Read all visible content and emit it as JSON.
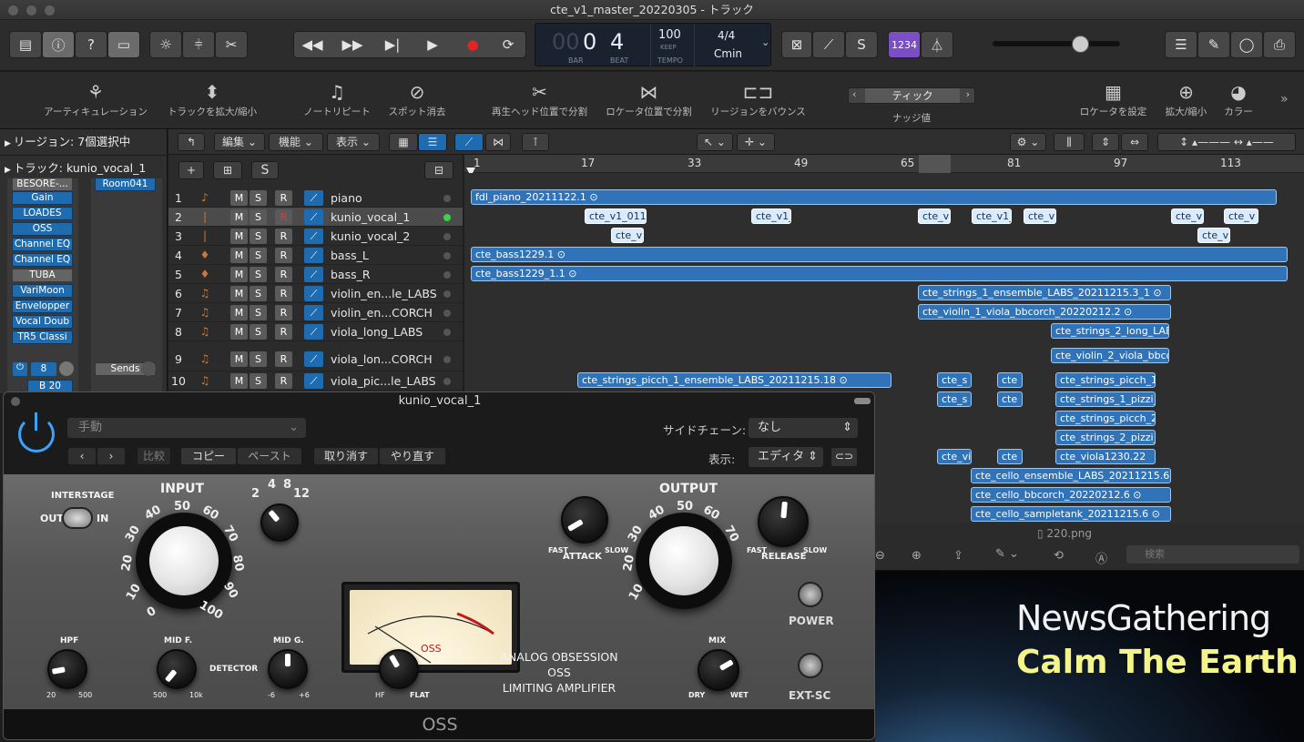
{
  "window": {
    "title": "cte_v1_master_20220305 - トラック"
  },
  "lcd": {
    "bar": "00",
    "beat_a": "0",
    "beat_b": "4",
    "bar_label": "BAR",
    "beat_label": "BEAT",
    "tempo": "100",
    "tempo_mode": "KEEP",
    "tempo_label": "TEMPO",
    "sig": "4/4",
    "key": "Cmin"
  },
  "toolbar": {
    "count_in": "1234"
  },
  "controlbar": {
    "items": [
      "アーティキュレーション",
      "トラックを拡大/縮小",
      "ノートリピート",
      "スポット消去",
      "再生ヘッド位置で分割",
      "ロケータ位置で分割",
      "リージョンをバウンス",
      "ナッジ値",
      "ロケータを設定",
      "拡大/縮小",
      "カラー"
    ],
    "nudge": "ティック"
  },
  "inspector": {
    "region_label": "リージョン:",
    "region_value": "7個選択中",
    "track_label": "トラック:",
    "track_value": "kunio_vocal_1",
    "slots": [
      "BESORE-...",
      "Gain",
      "LOADES",
      "OSS",
      "Channel EQ",
      "Channel EQ",
      "TUBA",
      "VariMoon",
      "Envelopper",
      "Vocal Doub",
      "TR5 Classi"
    ],
    "room": "Room041",
    "sends": "Sends",
    "bus": "B 20",
    "input": "8"
  },
  "menubar": {
    "edit": "編集",
    "func": "機能",
    "view": "表示"
  },
  "ruler": [
    "1",
    "17",
    "33",
    "49",
    "65",
    "81",
    "97",
    "113"
  ],
  "tracks": [
    {
      "num": "1",
      "name": "piano",
      "icon": "♪"
    },
    {
      "num": "2",
      "name": "kunio_vocal_1",
      "icon": "|"
    },
    {
      "num": "3",
      "name": "kunio_vocal_2",
      "icon": "|"
    },
    {
      "num": "4",
      "name": "bass_L",
      "icon": "♦"
    },
    {
      "num": "5",
      "name": "bass_R",
      "icon": "♦"
    },
    {
      "num": "6",
      "name": "violin_en...le_LABS",
      "icon": "♫"
    },
    {
      "num": "7",
      "name": "violin_en...CORCH",
      "icon": "♫"
    },
    {
      "num": "8",
      "name": "viola_long_LABS",
      "icon": "♫"
    },
    {
      "num": "9",
      "name": "viola_lon...CORCH",
      "icon": "♫"
    },
    {
      "num": "10",
      "name": "viola_pic...le_LABS",
      "icon": "♫"
    }
  ],
  "msr": {
    "m": "M",
    "s": "S",
    "r": "R"
  },
  "regions": [
    "fdl_piano_20211122.1",
    "cte_v1_011",
    "cte_v1_",
    "cte_v",
    "cte_v1_",
    "cte_v",
    "cte_v",
    "cte_v",
    "cte_v",
    "cte_v",
    "cte_bass1229.1",
    "cte_bass1229_1.1",
    "cte_strings_1_ensemble_LABS_20211215.3_1",
    "cte_violin_1_viola_bbcorch_20220212.2",
    "cte_strings_2_long_LAB",
    "cte_violin_2_viola_bbcor",
    "cte_strings_picch_1_ensemble_LABS_20211215.18",
    "cte_s",
    "cte",
    "cte_strings_picch_1",
    "cte_s",
    "cte",
    "cte_strings_1_pizzi_",
    "cte_strings_picch_2",
    "cte_strings_2_pizzi_",
    "cte_vi",
    "cte",
    "cte_viola1230.22",
    "cte_cello_ensemble_LABS_20211215.6",
    "cte_cello_bbcorch_20220212.6",
    "cte_cello_sampletank_20211215.6"
  ],
  "plugin": {
    "title": "kunio_vocal_1",
    "preset": "手動",
    "sidechain_label": "サイドチェーン:",
    "sidechain": "なし",
    "compare": "比較",
    "copy": "コピー",
    "paste": "ペースト",
    "undo": "取り消す",
    "redo": "やり直す",
    "view_label": "表示:",
    "view": "エディタ",
    "footer": "OSS"
  },
  "oss": {
    "interstage": "INTERSTAGE",
    "out": "OUT",
    "in": "IN",
    "input": "INPUT",
    "output": "OUTPUT",
    "ratio": [
      "2",
      "4",
      "8",
      "12"
    ],
    "input_scale": [
      "0",
      "10",
      "20",
      "30",
      "40",
      "50",
      "60",
      "70",
      "80",
      "90",
      "100"
    ],
    "attack": "ATTACK",
    "release": "RELEASE",
    "fast": "FAST",
    "slow": "SLOW",
    "power": "POWER",
    "hpf": "HPF",
    "hpf_min": "20",
    "hpf_max": "500",
    "midf": "MID F.",
    "midf_min": "500",
    "midf_max": "10k",
    "detector": "DETECTOR",
    "midg": "MID G.",
    "midg_min": "-6",
    "midg_max": "+6",
    "hf": "HF",
    "flat": "FLAT",
    "brand1": "ANALOG OBSESSION",
    "brand2": "OSS",
    "brand3": "LIMITING AMPLIFIER",
    "mix": "MIX",
    "dry": "DRY",
    "wet": "WET",
    "extsc": "EXT-SC",
    "meter_label": "OSS"
  },
  "preview": {
    "file": "220.png",
    "search": "検索",
    "line1": "NewsGathering",
    "line2": "Calm The Earth"
  }
}
